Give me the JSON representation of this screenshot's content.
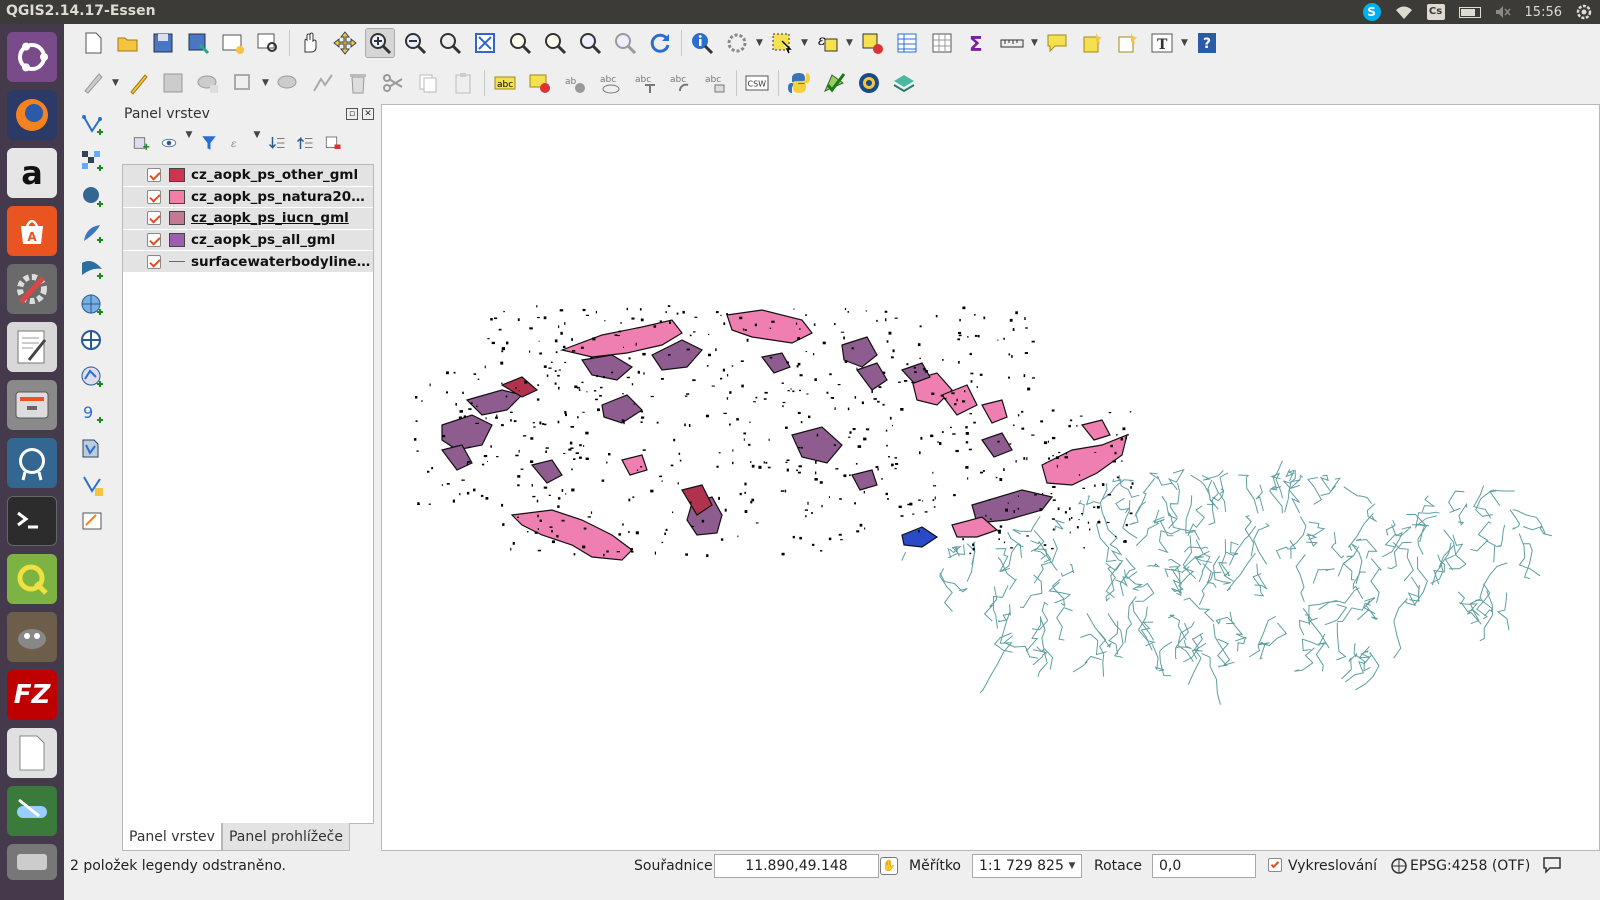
{
  "topbar": {
    "window_title": "QGIS2.14.17-Essen",
    "skype_glyph": "S",
    "keyboard_layout": "Cs",
    "clock": "15:56"
  },
  "launcher": {
    "items": [
      "ubuntu-dash-icon",
      "firefox-icon",
      "amazon-icon",
      "software-center-icon",
      "system-settings-icon",
      "text-editor-icon",
      "files-icon",
      "postgresql-icon",
      "terminal-icon",
      "qgis-icon",
      "gimp-icon",
      "filezilla-icon",
      "document-icon",
      "scanner-icon",
      "storage-icon"
    ],
    "amazon_glyph": "a",
    "filezilla_glyph": "FZ"
  },
  "layers_panel": {
    "title": "Panel vrstev",
    "layers": [
      {
        "name": "cz_aopk_ps_other_gml",
        "color": "#c9364f",
        "kind": "polygon"
      },
      {
        "name": "cz_aopk_ps_natura200…",
        "color": "#f27fa6",
        "kind": "polygon"
      },
      {
        "name": "cz_aopk_ps_iucn_gml",
        "color": "#c27a94",
        "kind": "polygon"
      },
      {
        "name": "cz_aopk_ps_all_gml",
        "color": "#9b5fae",
        "kind": "polygon"
      },
      {
        "name": "surfacewaterbodyline_…",
        "color": "#6a6a6a",
        "kind": "line"
      }
    ],
    "tabs": [
      "Panel vrstev",
      "Panel prohlížeče"
    ]
  },
  "statusbar": {
    "message": "2 položek legendy odstraněno.",
    "coords_label": "Souřadnice",
    "coords_value": "11.890,49.148",
    "scale_label": "Měřítko",
    "scale_value": "1:1 729 825",
    "rotation_label": "Rotace",
    "rotation_value": "0,0",
    "render_label": "Vykreslování",
    "crs": "EPSG:4258 (OTF)"
  },
  "toolbar": {
    "label_abc": "abc",
    "csw_label": "CSW"
  },
  "colors": {
    "river": "#5f9ea0",
    "protected_all": "#8e5c8e",
    "natura": "#ef7fb0",
    "other": "#b0324d"
  }
}
